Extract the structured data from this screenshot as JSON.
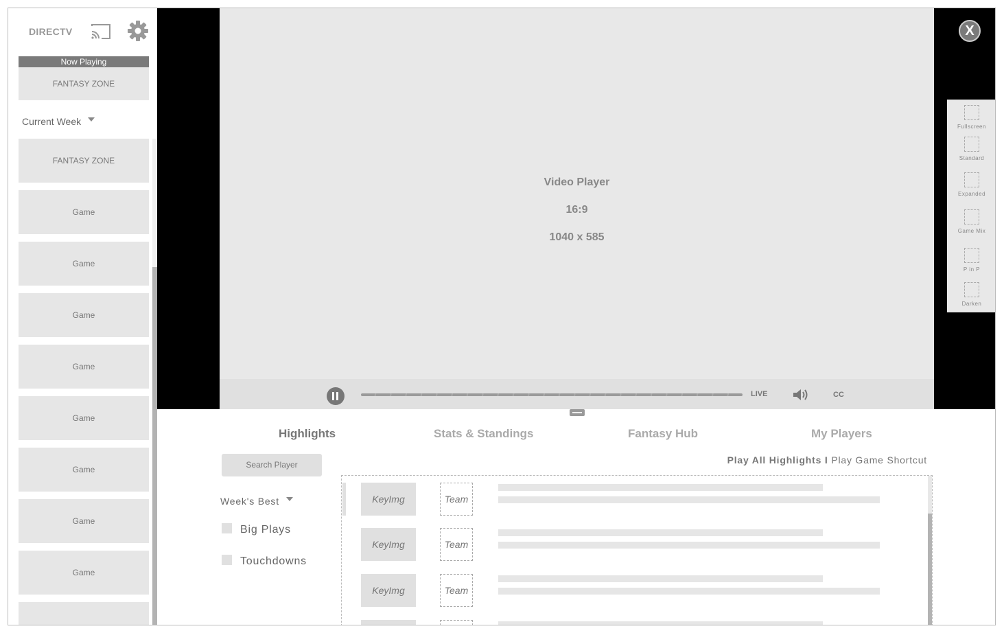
{
  "sidebar": {
    "brand": "DIRECTV",
    "now_playing_label": "Now Playing",
    "now_playing_tile": "FANTASY ZONE",
    "week_selector": "Current Week",
    "tiles": [
      "FANTASY ZONE",
      "Game",
      "Game",
      "Game",
      "Game",
      "Game",
      "Game",
      "Game",
      "Game",
      ""
    ]
  },
  "video": {
    "title": "Video Player",
    "ratio": "16:9",
    "size": "1040 x 585",
    "live_label": "LIVE",
    "cc_label": "CC"
  },
  "view_modes": [
    "Fullscreen",
    "Standard",
    "Expanded",
    "Game Mix",
    "P in P",
    "Darken"
  ],
  "close_label": "X",
  "tabs": [
    {
      "label": "Highlights",
      "active": true
    },
    {
      "label": "Stats & Standings",
      "active": false
    },
    {
      "label": "Fantasy Hub",
      "active": false
    },
    {
      "label": "My Players",
      "active": false
    }
  ],
  "filters": {
    "search_button": "Search Player",
    "week_filter": "Week's Best",
    "checkboxes": [
      "Big Plays",
      "Touchdowns"
    ]
  },
  "highlight_links": {
    "play_all": "Play All Highlights",
    "separator": "I",
    "shortcut": "Play Game Shortcut"
  },
  "results": [
    {
      "image": "KeyImg",
      "team": "Team"
    },
    {
      "image": "KeyImg",
      "team": "Team"
    },
    {
      "image": "KeyImg",
      "team": "Team"
    },
    {
      "image": "",
      "team": ""
    }
  ]
}
